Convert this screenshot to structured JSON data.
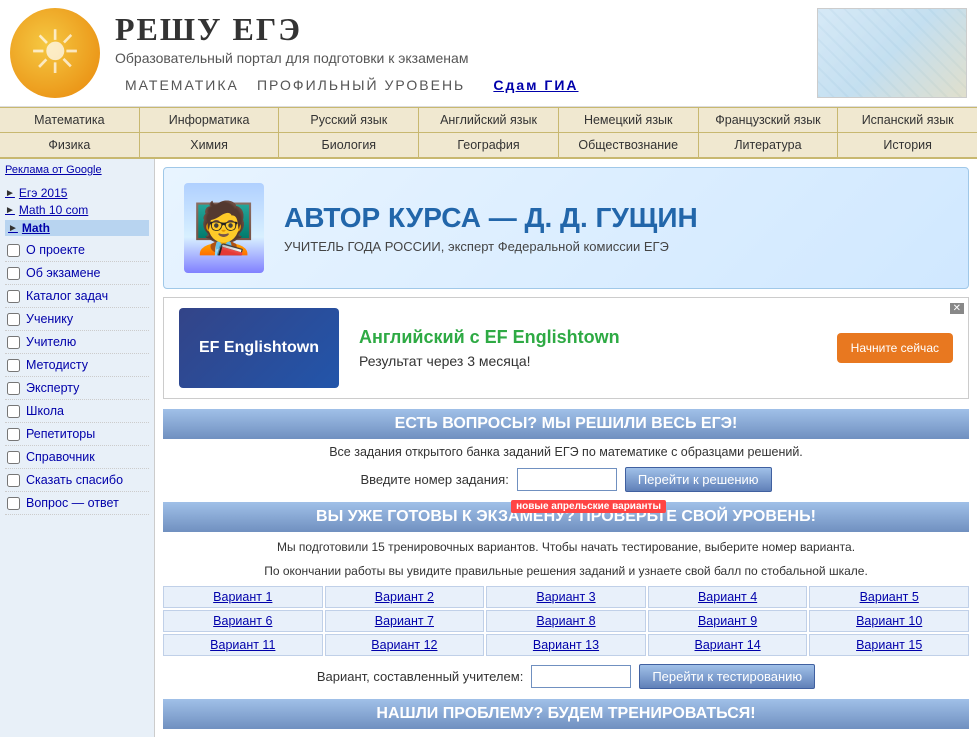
{
  "header": {
    "site_title": "РЕШУ ЕГЭ",
    "site_subtitle": "Образовательный портал для подготовки к экзаменам",
    "site_subject": "МАТЕМАТИКА",
    "site_level": "ПРОФИЛЬНЫЙ УРОВЕНЬ",
    "sdam_gia": "Сдам ГИА"
  },
  "nav1": {
    "items": [
      "Математика",
      "Информатика",
      "Русский язык",
      "Английский язык",
      "Немецкий язык",
      "Французский язык",
      "Испанский язык"
    ]
  },
  "nav2": {
    "items": [
      "Физика",
      "Химия",
      "Биология",
      "География",
      "Обществознание",
      "Литература",
      "История"
    ]
  },
  "sidebar": {
    "ads_label": "Реклама от Google",
    "ad_links": [
      {
        "text": "Егэ 2015"
      },
      {
        "text": "Math 10 com"
      },
      {
        "text": "Math",
        "highlight": true
      }
    ],
    "links": [
      {
        "text": "О проекте"
      },
      {
        "text": "Об экзамене"
      },
      {
        "text": "Каталог задач"
      },
      {
        "text": "Ученику"
      },
      {
        "text": "Учителю"
      },
      {
        "text": "Методисту"
      },
      {
        "text": "Эксперту"
      },
      {
        "text": "Школа"
      },
      {
        "text": "Репетиторы"
      },
      {
        "text": "Справочник"
      },
      {
        "text": "Сказать спасибо"
      },
      {
        "text": "Вопрос — ответ"
      }
    ]
  },
  "author_banner": {
    "title": "АВТОР КУРСА — Д. Д. ГУЩИН",
    "subtitle": "УЧИТЕЛЬ ГОДА РОССИИ, эксперт Федеральной комиссии ЕГЭ"
  },
  "ef_banner": {
    "logo_text": "EF Englishtown",
    "title": "Английский с EF Englishtown",
    "subtitle": "Результат через 3 месяца!",
    "button": "Начните сейчас"
  },
  "questions_section": {
    "header": "ЕСТЬ ВОПРОСЫ? МЫ РЕШИЛИ ВЕСЬ ЕГЭ!",
    "text": "Все задания открытого банка заданий ЕГЭ по математике с образцами решений.",
    "input_label": "Введите номер задания:",
    "button": "Перейти к решению",
    "input_placeholder": ""
  },
  "variants_section": {
    "header": "ВЫ УЖЕ ГОТОВЫ К ЭКЗАМЕНУ? ПРОВЕРЬТЕ СВОЙ УРОВЕНЬ!",
    "new_badge": "новые апрельские варианты",
    "text1": "Мы подготовили 15 тренировочных вариантов. Чтобы начать тестирование, выберите номер варианта.",
    "text2": "По окончании работы вы увидите правильные решения заданий и узнаете свой балл по стобальной шкале.",
    "variants": [
      "Вариант 1",
      "Вариант 2",
      "Вариант 3",
      "Вариант 4",
      "Вариант 5",
      "Вариант 6",
      "Вариант 7",
      "Вариант 8",
      "Вариант 9",
      "Вариант 10",
      "Вариант 11",
      "Вариант 12",
      "Вариант 13",
      "Вариант 14",
      "Вариант 15"
    ],
    "teacher_label": "Вариант, составленный учителем:",
    "teacher_button": "Перейти к тестированию",
    "teacher_input_placeholder": ""
  },
  "bottom_section": {
    "header": "НАШЛИ ПРОБЛЕМУ? БУДЕМ ТРЕНИРОВАТЬСЯ!"
  }
}
